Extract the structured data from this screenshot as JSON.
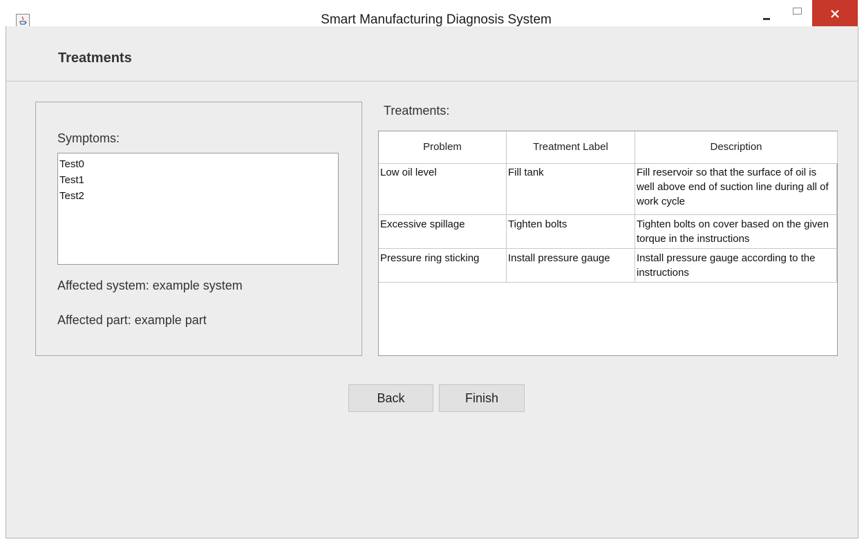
{
  "window": {
    "title": "Smart Manufacturing Diagnosis System"
  },
  "header": {
    "title": "Treatments"
  },
  "symptoms": {
    "label": "Symptoms:",
    "items": [
      "Test0",
      "Test1",
      "Test2"
    ],
    "affected_system": "Affected system: example system",
    "affected_part": "Affected part: example part"
  },
  "treatments": {
    "label": "Treatments:",
    "columns": [
      "Problem",
      "Treatment Label",
      "Description"
    ],
    "rows": [
      {
        "problem": "Low oil level",
        "label": "Fill tank",
        "description": "Fill reservoir so that the surface of oil is well above end of suction line during all of work cycle"
      },
      {
        "problem": "Excessive spillage",
        "label": "Tighten bolts",
        "description": "Tighten bolts on cover based on the given torque in the instructions"
      },
      {
        "problem": "Pressure ring sticking",
        "label": "Install pressure gauge",
        "description": "Install pressure gauge according to the instructions"
      }
    ]
  },
  "buttons": {
    "back": "Back",
    "finish": "Finish"
  },
  "icons": {
    "app": "java-app-icon",
    "minimize": "minimize-icon",
    "maximize": "maximize-icon",
    "close": "close-icon"
  },
  "colors": {
    "close_button": "#c7382b",
    "panel_background": "#ededed"
  }
}
